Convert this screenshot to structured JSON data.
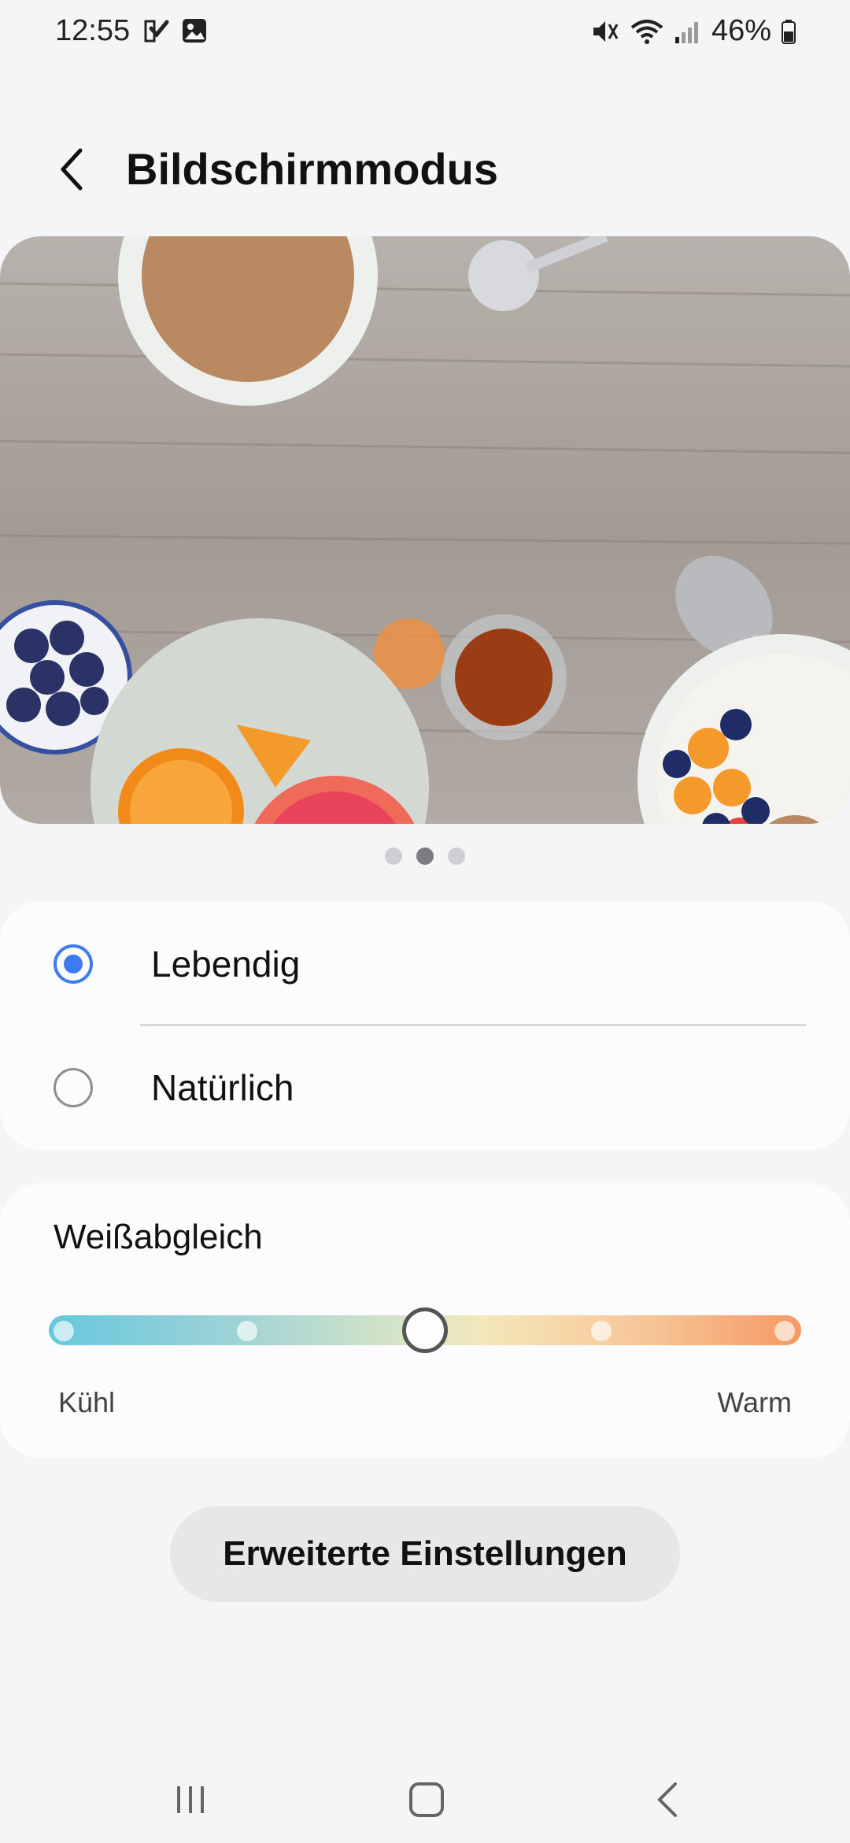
{
  "status_bar": {
    "time": "12:55",
    "battery": "46%"
  },
  "header": {
    "title": "Bildschirmmodus"
  },
  "preview": {
    "page_count": 3,
    "active_page": 2
  },
  "screen_mode": {
    "options": [
      {
        "label": "Lebendig",
        "selected": true
      },
      {
        "label": "Natürlich",
        "selected": false
      }
    ]
  },
  "white_balance": {
    "title": "Weißabgleich",
    "min_label": "Kühl",
    "max_label": "Warm",
    "steps": 5,
    "value_step": 3
  },
  "advanced_button": {
    "label": "Erweiterte Einstellungen"
  },
  "colors": {
    "accent": "#3e7bf0",
    "background": "#f5f5f7",
    "card": "#fcfcfe"
  }
}
